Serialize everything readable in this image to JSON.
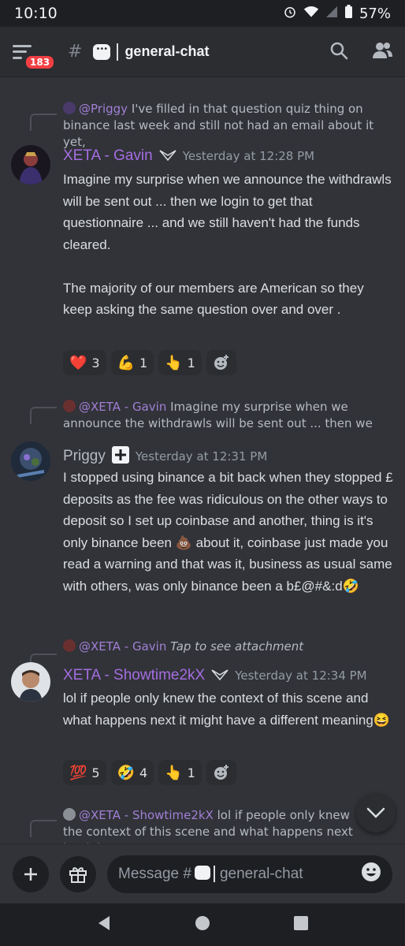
{
  "status": {
    "time": "10:10",
    "battery": "57%"
  },
  "header": {
    "badge": "183",
    "channel": "general-chat"
  },
  "messages": [
    {
      "reply_name": "@Priggy",
      "reply_text": "I've filled in that question quiz thing on binance last week and still not had an email about it yet,",
      "author": "XETA - Gavin",
      "timestamp": "Yesterday at 12:28 PM",
      "text": "Imagine my surprise when we announce the withdrawls will be sent out ... then we login to get that questionnaire ... and we still haven't had the funds cleared.\n\nThe majority of our members are American so they keep asking the same question over and over .",
      "reactions": [
        {
          "emoji": "❤️",
          "count": "3"
        },
        {
          "emoji": "💪",
          "count": "1"
        },
        {
          "emoji": "👆",
          "count": "1"
        }
      ]
    },
    {
      "reply_name": "@XETA - Gavin",
      "reply_text": "Imagine my surprise when we announce the withdrawls will be sent out ... then we",
      "author": "Priggy",
      "timestamp": "Yesterday at 12:31 PM",
      "text": "I stopped using binance a bit back when they stopped £ deposits as the fee was ridiculous on the other ways to deposit so I set up coinbase and another, thing is it's only binance been 💩 about it, coinbase just made you read a warning and that was it, business as usual same with others, was only binance been a b£@#&:d🤣"
    },
    {
      "reply_name": "@XETA - Gavin",
      "reply_text": "Tap to see attachment",
      "author": "XETA - Showtime2kX",
      "timestamp": "Yesterday at 12:34 PM",
      "text": "lol if people only knew the context of this scene and what happens next it might have a different meaning😆",
      "reactions": [
        {
          "emoji": "💯",
          "count": "5"
        },
        {
          "emoji": "🤣",
          "count": "4"
        },
        {
          "emoji": "👆",
          "count": "1"
        }
      ]
    },
    {
      "reply_name": "@XETA - Showtime2kX",
      "reply_text": "lol if people only knew the context of this scene and what happens next it might"
    }
  ],
  "composer": {
    "placeholder_prefix": "Message #",
    "placeholder_channel": "general-chat"
  },
  "colors": {
    "background": "#313338",
    "author_purple": "#a56de2",
    "author_gray": "#b5bac1",
    "badge_red": "#f23f43"
  }
}
